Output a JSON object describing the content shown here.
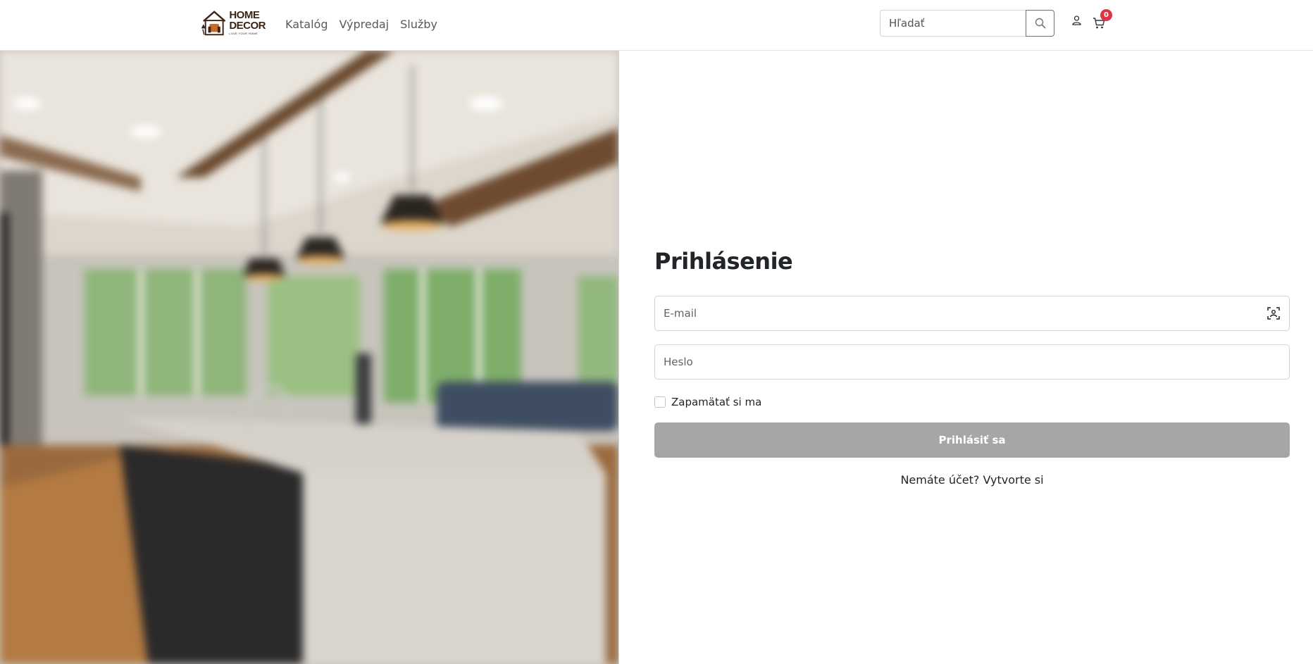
{
  "header": {
    "logo": {
      "line1": "HOME",
      "line2": "DECOR",
      "tagline": "LOVE YOUR HOME"
    },
    "nav": [
      {
        "label": "Katalóg"
      },
      {
        "label": "Výpredaj"
      },
      {
        "label": "Služby"
      }
    ],
    "search": {
      "placeholder": "Hľadať",
      "value": ""
    },
    "cart_count": "0"
  },
  "icons": {
    "search": "search-icon",
    "user": "user-icon",
    "cart": "cart-icon",
    "autofill": "autofill-icon"
  },
  "login": {
    "title": "Prihlásenie",
    "email_placeholder": "E-mail",
    "email_value": "",
    "password_placeholder": "Heslo",
    "password_value": "",
    "remember_label": "Zapamätať si ma",
    "remember_checked": false,
    "submit_label": "Prihlásiť sa",
    "signup_prompt": "Nemáte účet?",
    "signup_link": "Vytvorte si"
  },
  "colors": {
    "badge": "#dc3545",
    "submit_disabled": "#a6a6a6",
    "logo_brown": "#3b2416"
  }
}
